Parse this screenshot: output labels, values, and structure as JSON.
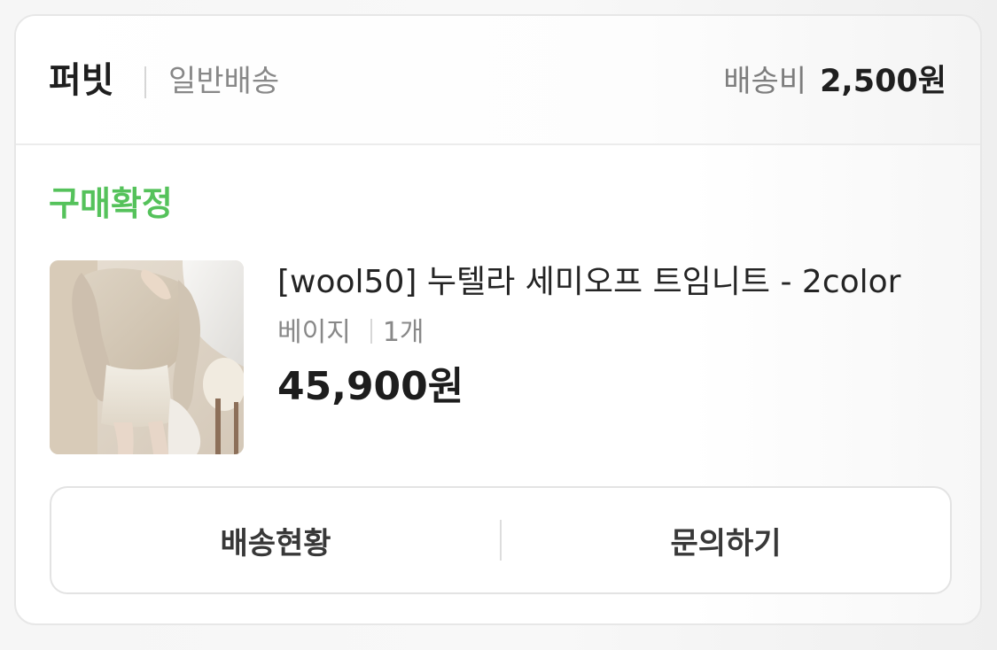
{
  "order": {
    "seller": "퍼빗",
    "shipping_type": "일반배송",
    "shipping_fee_label": "배송비",
    "shipping_fee_value": "2,500원",
    "status": "구매확정",
    "product": {
      "title": "[wool50] 누텔라 세미오프 트임니트 - 2color",
      "option_color": "베이지",
      "quantity": "1개",
      "price": "45,900원"
    },
    "actions": {
      "tracking_label": "배송현황",
      "inquiry_label": "문의하기"
    }
  },
  "colors": {
    "status_green": "#55c25b",
    "card_border": "#e7e7e7",
    "muted_text": "#888888"
  },
  "icons": {
    "thumbnail": "product-image-knit-sweater"
  }
}
